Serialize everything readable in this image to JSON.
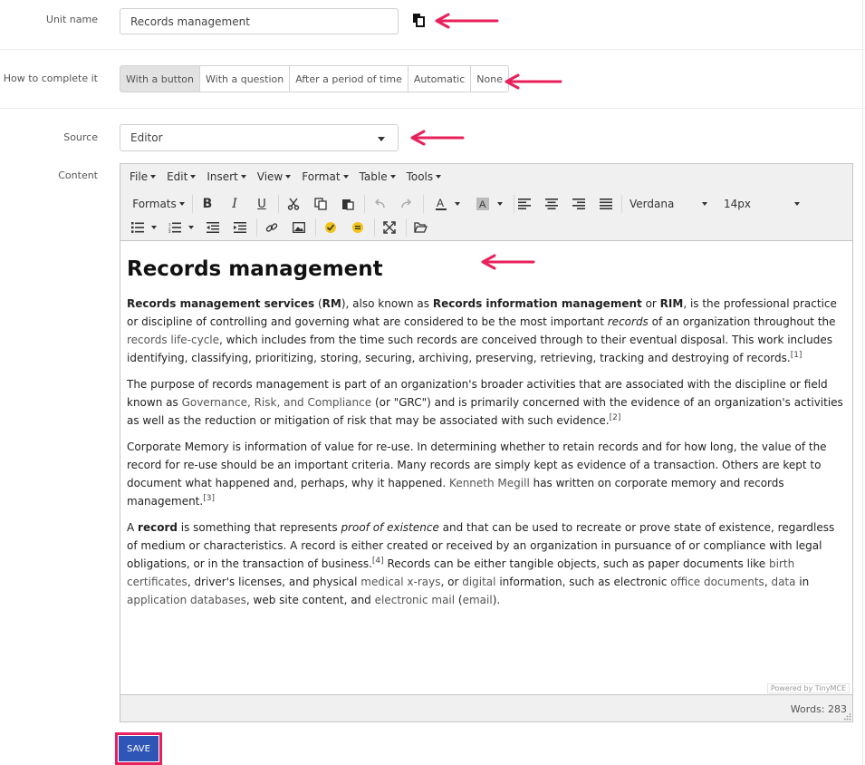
{
  "form": {
    "unit_name_label": "Unit name",
    "unit_name_value": "Records management",
    "completion_label": "How to complete it",
    "completion_options": [
      "With a button",
      "With a question",
      "After a period of time",
      "Automatic",
      "None"
    ],
    "completion_selected": "With a button",
    "source_label": "Source",
    "source_value": "Editor",
    "content_label": "Content",
    "save_label": "SAVE"
  },
  "editor": {
    "menus": [
      "File",
      "Edit",
      "Insert",
      "View",
      "Format",
      "Table",
      "Tools"
    ],
    "formats_label": "Formats",
    "bold_glyph": "B",
    "italic_glyph": "I",
    "underline_glyph": "U",
    "font_family": "Verdana",
    "font_size": "14px",
    "powered_by": "Powered by TinyMCE",
    "word_count": "Words: 283"
  },
  "content": {
    "title": "Records management",
    "p1": {
      "b1": "Records management services",
      "t1": " (",
      "b2": "RM",
      "t2": "), also known as ",
      "b3": "Records information management",
      "t3": " or ",
      "b4": "RIM",
      "t4": ", is the professional practice or discipline of controlling and governing what are considered to be the most important ",
      "i1": "records",
      "t5": " of an organization throughout the ",
      "l1": "records life-cycle",
      "t6": ", which includes from the time such records are conceived through to their eventual disposal. This work includes identifying, classifying, prioritizing, storing, securing, archiving, preserving, retrieving, tracking and destroying of records.",
      "s1": "[1]"
    },
    "p2": {
      "t1": "The purpose of records management is part of an organization's broader activities that are associated with the discipline or field known as ",
      "l1": "Governance, Risk, and Compliance",
      "t2": " (or \"GRC\") and is primarily concerned with the evidence of an organization's activities as well as the reduction or mitigation of risk that may be associated with such evidence.",
      "s1": "[2]"
    },
    "p3": {
      "t1": "Corporate Memory is information of value for re-use. In determining whether to retain records and for how long, the value of the record for re-use should be an important criteria. Many records are simply kept as evidence of a transaction. Others are kept to document what happened and, perhaps, why it happened. ",
      "l1": "Kenneth Megill",
      "t2": " has written on corporate memory and records management.",
      "s1": "[3]"
    },
    "p4": {
      "t1": "A ",
      "b1": "record",
      "t2": " is something that represents ",
      "i1": "proof of existence",
      "t3": " and that can be used to recreate or prove state of existence, regardless of medium or characteristics. A record is either created or received by an organization in pursuance of or compliance with legal obligations, or in the transaction of business.",
      "s1": "[4]",
      "t4": " Records can be either tangible objects, such as paper documents like ",
      "l1": "birth certificates",
      "t5": ", driver's licenses, and physical ",
      "l2": "medical x-rays",
      "t6": ", or ",
      "l3": "digital",
      "t7": " information, such as electronic ",
      "l4": "office documents",
      "t8": ", ",
      "l5": "data",
      "t9": " in ",
      "l6": "application databases",
      "t10": ", web site content, and ",
      "l7": "electronic mail",
      "t11": " (",
      "l8": "email",
      "t12": ")."
    }
  },
  "colors": {
    "accent_arrow": "#e8215c",
    "save_bg": "#2f55b6",
    "toolbar_bg": "#f0f0f0",
    "link": "#555555"
  }
}
